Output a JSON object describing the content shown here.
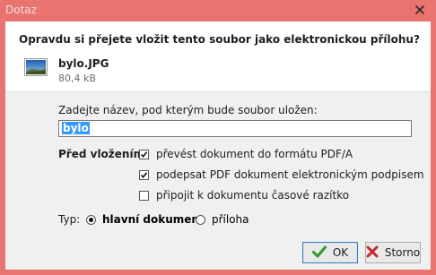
{
  "window": {
    "title": "Dotaz"
  },
  "header": {
    "question": "Opravdu si přejete vložit tento soubor jako elektronickou přílohu?",
    "file_name": "bylo.JPG",
    "file_size": "80,4 kB"
  },
  "form": {
    "name_label": "Zadejte název, pod kterým bude soubor uložen:",
    "name_value": "bylo",
    "before_label": "Před vložením",
    "options": [
      {
        "label": "převést dokument do formátu PDF/A",
        "checked": true
      },
      {
        "label": "podepsat PDF dokument elektronickým podpisem",
        "checked": true
      },
      {
        "label": "připojit k dokumentu časové razítko",
        "checked": false
      }
    ],
    "type_label": "Typ:",
    "type_options": [
      {
        "label": "hlavní dokument",
        "selected": true
      },
      {
        "label": "příloha",
        "selected": false
      }
    ]
  },
  "buttons": {
    "ok": "OK",
    "cancel": "Storno"
  },
  "colors": {
    "title_bar": "#e8736f",
    "selection": "#3399ff",
    "ok_icon": "#2e9a2e",
    "cancel_icon": "#c42a2a"
  },
  "icons": {
    "close": "close-icon",
    "file": "image-file-icon",
    "ok": "checkmark-icon",
    "cancel": "x-icon"
  }
}
